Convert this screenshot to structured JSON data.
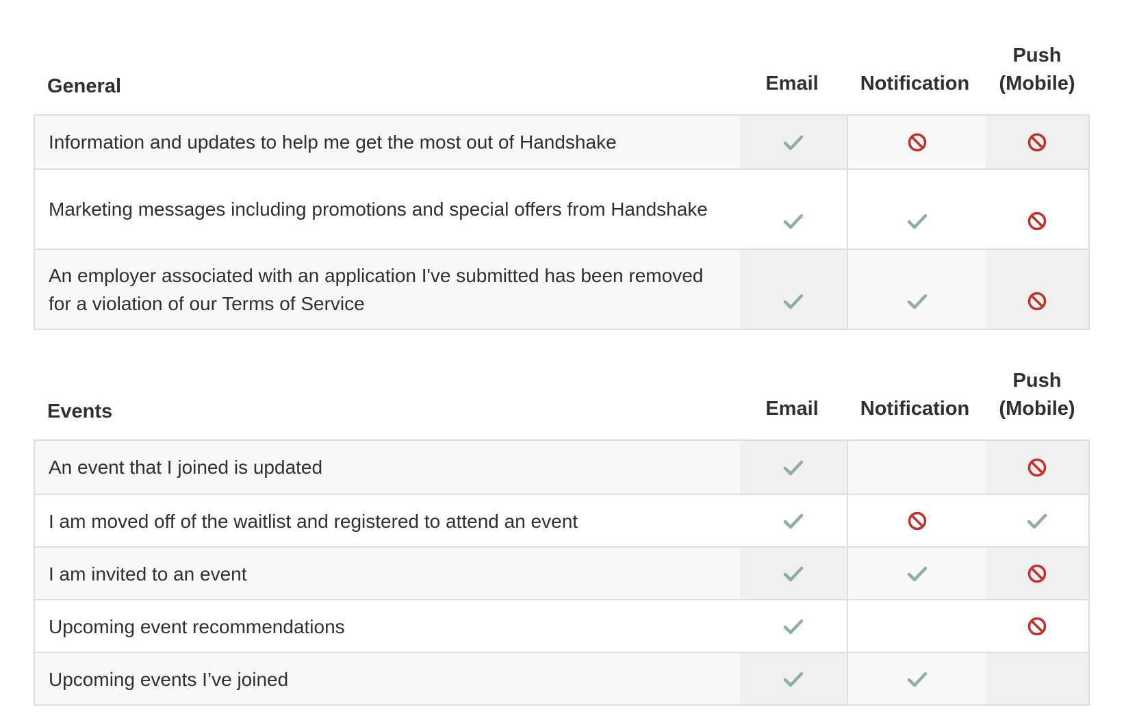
{
  "columns": {
    "email": "Email",
    "notification": "Notification",
    "push_line1": "Push",
    "push_line2": "(Mobile)"
  },
  "icons": {
    "enabled": "check-icon",
    "disabled": "blocked-icon",
    "check_color": "#8fada8",
    "blocked_color": "#c0312b"
  },
  "sections": [
    {
      "title": "General",
      "rows": [
        {
          "label": "Information and updates to help me get the most out of Handshake",
          "email": "check",
          "notification": "blocked",
          "push": "blocked"
        },
        {
          "label": "Marketing messages including promotions and special offers from Handshake",
          "email": "check",
          "notification": "check",
          "push": "blocked"
        },
        {
          "label": "An employer associated with an application I've submitted has been removed for a violation of our Terms of Service",
          "email": "check",
          "notification": "check",
          "push": "blocked"
        }
      ]
    },
    {
      "title": "Events",
      "rows": [
        {
          "label": "An event that I joined is updated",
          "email": "check",
          "notification": "none",
          "push": "blocked"
        },
        {
          "label": "I am moved off of the waitlist and registered to attend an event",
          "email": "check",
          "notification": "blocked",
          "push": "check"
        },
        {
          "label": "I am invited to an event",
          "email": "check",
          "notification": "check",
          "push": "blocked"
        },
        {
          "label": "Upcoming event recommendations",
          "email": "check",
          "notification": "none",
          "push": "blocked"
        },
        {
          "label": "Upcoming events I’ve joined",
          "email": "check",
          "notification": "check",
          "push": "none"
        }
      ]
    }
  ]
}
